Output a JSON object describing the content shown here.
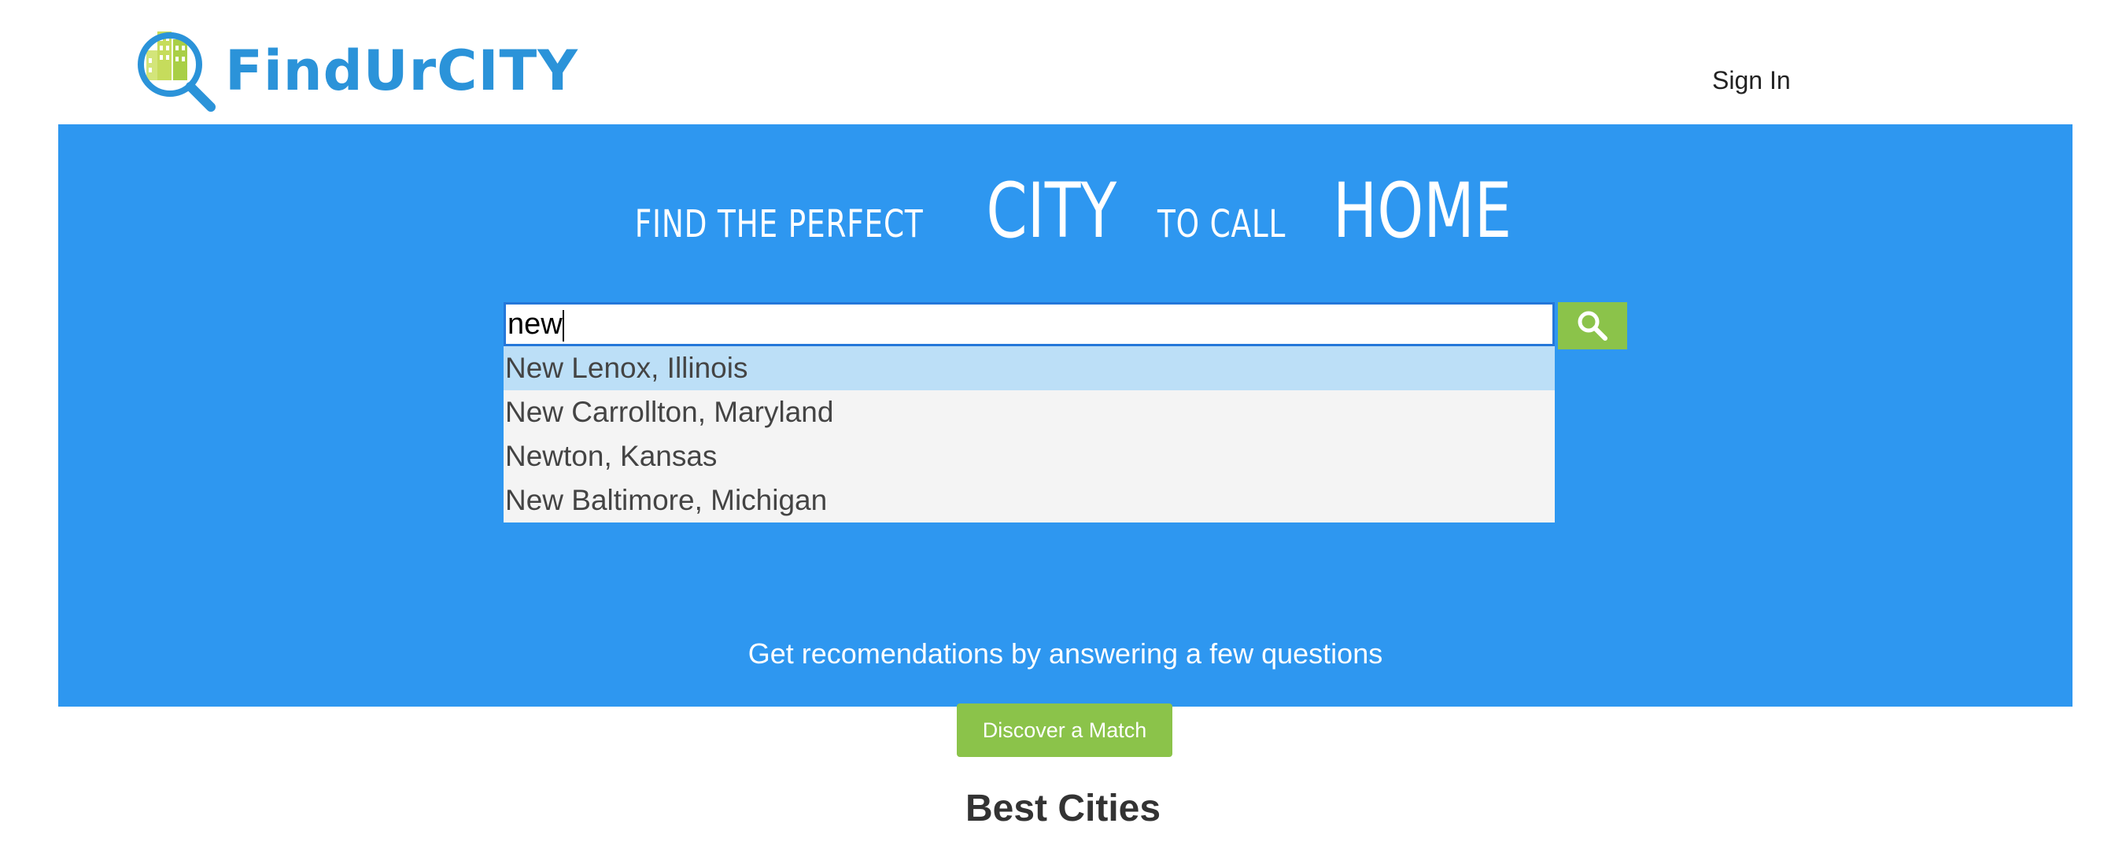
{
  "header": {
    "logo_text": "FindUrCITY",
    "signin_label": "Sign In"
  },
  "hero": {
    "tagline": {
      "part1": "FIND THE PERFECT",
      "part2": "CITY",
      "part3": "TO CALL",
      "part4": "HOME"
    },
    "search": {
      "value": "new",
      "button_icon": "search-icon"
    },
    "suggestions": [
      "New Lenox, Illinois",
      "New Carrollton, Maryland",
      "Newton, Kansas",
      "New Baltimore, Michigan"
    ],
    "recommend_text": "Get recomendations by answering a few questions"
  },
  "discover_label": "Discover a Match",
  "best_title": "Best Cities",
  "colors": {
    "brand_blue": "#2b93d9",
    "hero_blue": "#2e97f0",
    "accent_green": "#8bc34a",
    "highlight": "#bcdff7"
  }
}
